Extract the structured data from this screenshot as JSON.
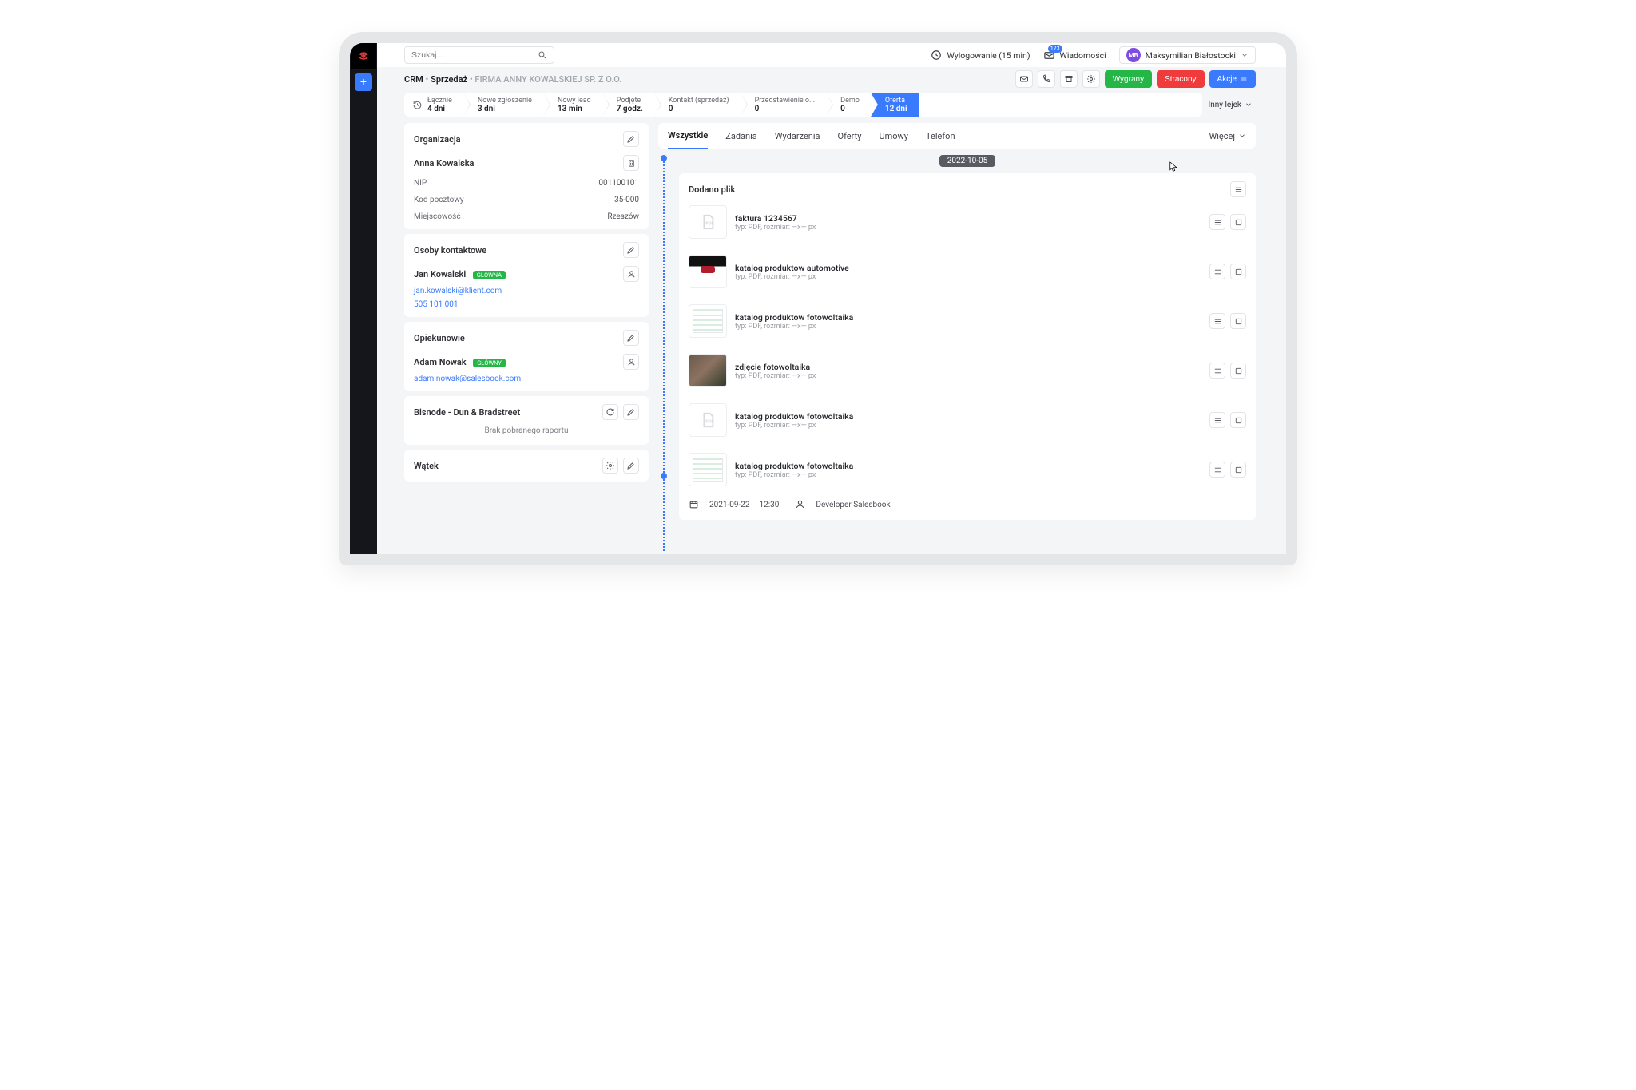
{
  "app": {
    "logo_letter": "S"
  },
  "topbar": {
    "search_placeholder": "Szukaj...",
    "logout_label": "Wylogowanie (15 min)",
    "messages_label": "Wiadomości",
    "messages_count": "123",
    "user_initials": "MB",
    "user_name": "Maksymilian Białostocki"
  },
  "breadcrumb": {
    "root": "CRM",
    "section": "Sprzedaż",
    "entity": "FIRMA ANNY KOWALSKIEJ SP. Z O.O."
  },
  "actions": {
    "win": "Wygrany",
    "lose": "Stracony",
    "menu": "Akcje"
  },
  "funnel": {
    "stages": [
      {
        "t": "Łącznie",
        "v": "4 dni"
      },
      {
        "t": "Nowe zgłoszenie",
        "v": "3 dni"
      },
      {
        "t": "Nowy lead",
        "v": "13 min"
      },
      {
        "t": "Podjęte",
        "v": "7 godz."
      },
      {
        "t": "Kontakt (sprzedaż)",
        "v": "0"
      },
      {
        "t": "Przedstawienie o...",
        "v": "0"
      },
      {
        "t": "Demo",
        "v": "0"
      },
      {
        "t": "Oferta",
        "v": "12 dni"
      }
    ],
    "other": "Inny lejek"
  },
  "tabs": {
    "items": [
      "Wszystkie",
      "Zadania",
      "Wydarzenia",
      "Oferty",
      "Umowy",
      "Telefon"
    ],
    "more": "Więcej"
  },
  "left": {
    "organization": {
      "title": "Organizacja",
      "name": "Anna Kowalska",
      "fields": [
        {
          "k": "NIP",
          "v": "001100101"
        },
        {
          "k": "Kod pocztowy",
          "v": "35-000"
        },
        {
          "k": "Miejscowość",
          "v": "Rzeszów"
        }
      ]
    },
    "contacts": {
      "title": "Osoby kontaktowe",
      "primary_badge": "GŁÓWNA",
      "person": "Jan Kowalski",
      "email": "jan.kowalski@klient.com",
      "phone": "505 101 001"
    },
    "owners": {
      "title": "Opiekunowie",
      "primary_badge": "GŁÓWNY",
      "person": "Adam Nowak",
      "email": "adam.nowak@salesbook.com"
    },
    "bisnode": {
      "title": "Bisnode - Dun & Bradstreet",
      "empty": "Brak pobranego raportu"
    },
    "thread": {
      "title": "Wątek"
    }
  },
  "feed": {
    "date": "2022-10-05",
    "added_file": "Dodano plik",
    "files": [
      {
        "name": "faktura 1234567",
        "sub": "typ: PDF, rozmiar: —x— px",
        "thumb": "pdf"
      },
      {
        "name": "katalog produktow automotive",
        "sub": "typ: PDF, rozmiar: —x— px",
        "thumb": "img1"
      },
      {
        "name": "katalog produktow fotowoltaika",
        "sub": "typ: PDF, rozmiar: —x— px",
        "thumb": "img2"
      },
      {
        "name": "zdjęcie fotowoltaika",
        "sub": "typ: PDF, rozmiar: —x— px",
        "thumb": "img3"
      },
      {
        "name": "katalog produktow fotowoltaika",
        "sub": "typ: PDF, rozmiar: —x— px",
        "thumb": "pdf"
      },
      {
        "name": "katalog produktow fotowoltaika",
        "sub": "typ: PDF, rozmiar: —x— px",
        "thumb": "img2"
      }
    ],
    "footer_date": "2021-09-22",
    "footer_time": "12:30",
    "author": "Developer Salesbook"
  }
}
